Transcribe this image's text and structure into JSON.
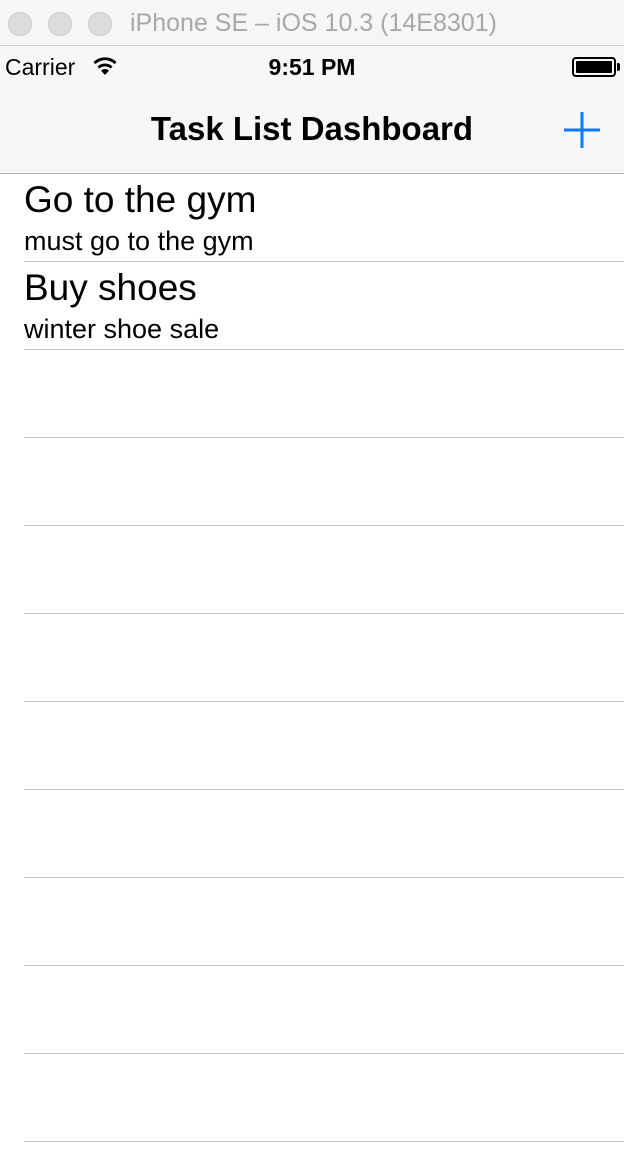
{
  "window": {
    "title": "iPhone SE – iOS 10.3 (14E8301)"
  },
  "status_bar": {
    "carrier": "Carrier",
    "time": "9:51 PM",
    "wifi_icon": "wifi-icon",
    "battery_icon": "battery-icon",
    "battery_level": 1.0
  },
  "nav_bar": {
    "title": "Task List Dashboard",
    "add_icon": "plus-icon",
    "accent_color": "#0a7aff"
  },
  "tasks": [
    {
      "title": "Go to the gym",
      "subtitle": "must go to the gym"
    },
    {
      "title": "Buy shoes",
      "subtitle": "winter shoe sale"
    }
  ],
  "empty_row_count": 9
}
